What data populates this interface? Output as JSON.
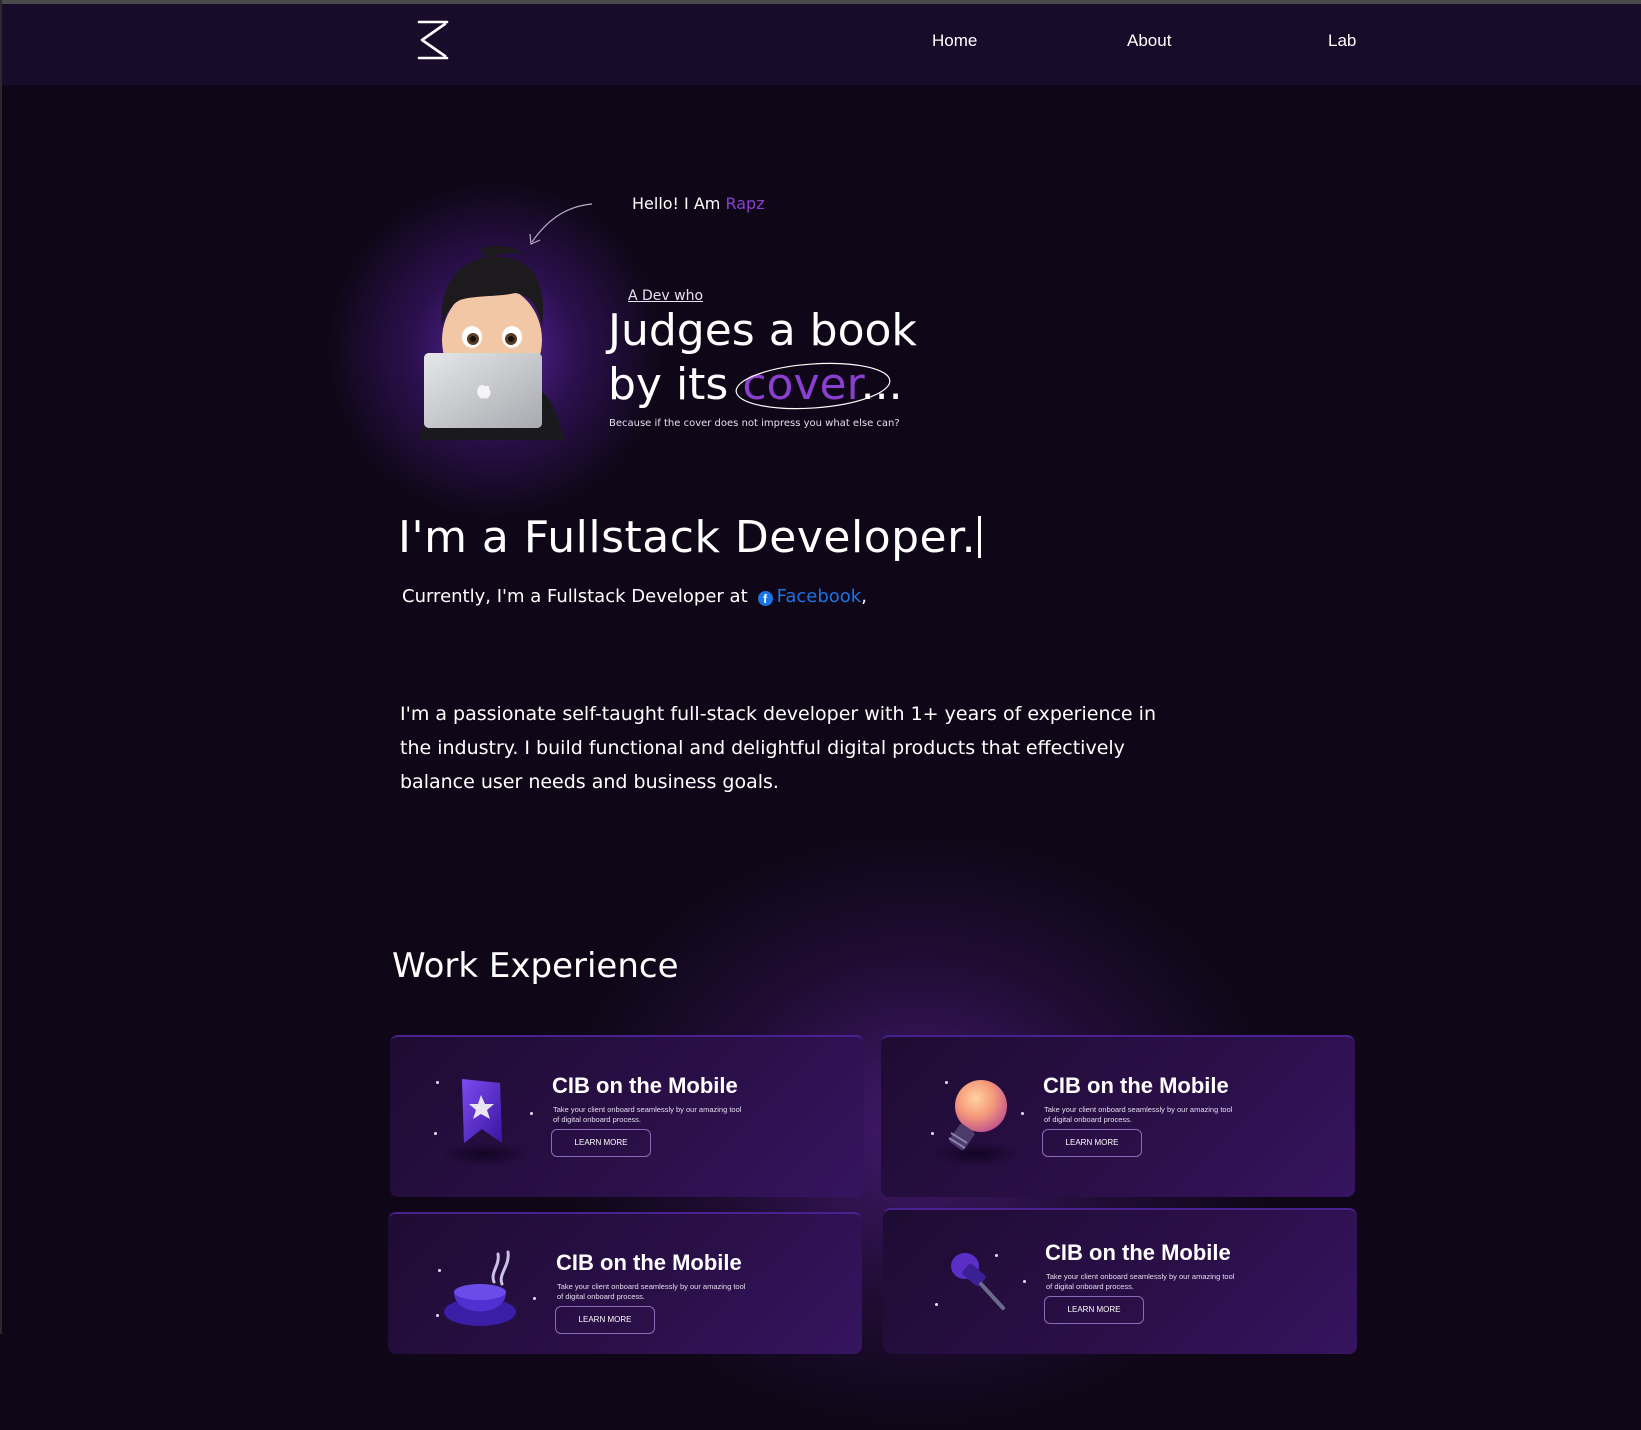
{
  "nav": {
    "logo_icon": "k-logo-icon",
    "items": [
      {
        "label": "Home"
      },
      {
        "label": "About"
      },
      {
        "label": "Lab"
      }
    ]
  },
  "hero": {
    "hello_prefix": "Hello! I Am ",
    "hello_name": "Rapz",
    "dev_who": "A Dev who",
    "headline_line1": "Judges a book",
    "headline_line2_prefix": "by its ",
    "headline_highlight": "cover",
    "headline_suffix": "...",
    "subline": "Because if the cover does not impress you what else can?",
    "avatar_icon": "memoji-laptop-avatar",
    "accent_color": "#8a3fd1"
  },
  "role": {
    "title": "I'm a Fullstack Developer.",
    "current_prefix": "Currently, I'm a Fullstack Developer at",
    "company": "Facebook",
    "company_suffix": ",",
    "company_icon": "facebook-icon",
    "company_color": "#1b74e4"
  },
  "bio": {
    "text": "I'm a passionate self-taught full-stack developer with 1+ years of experience in the industry. I build functional and delightful digital products that effectively balance user needs and business goals."
  },
  "work": {
    "heading": "Work Experience",
    "cards": [
      {
        "title": "CIB on the Mobile",
        "desc": "Take your client onboard seamlessly by our amazing tool of digital onboard process.",
        "button": "LEARN MORE",
        "icon": "bookmark-star-icon"
      },
      {
        "title": "CIB on the Mobile",
        "desc": "Take your client onboard seamlessly by our amazing tool of digital onboard process.",
        "button": "LEARN MORE",
        "icon": "lightbulb-icon"
      },
      {
        "title": "CIB on the Mobile",
        "desc": "Take your client onboard seamlessly by our amazing tool of digital onboard process.",
        "button": "LEARN MORE",
        "icon": "coffee-cup-icon"
      },
      {
        "title": "CIB on the Mobile",
        "desc": "Take your client onboard seamlessly by our amazing tool of digital onboard process.",
        "button": "LEARN MORE",
        "icon": "pin-icon"
      }
    ]
  }
}
